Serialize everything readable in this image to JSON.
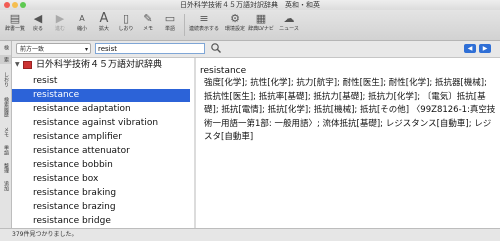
{
  "window": {
    "title": "日外科学技術４５万語対訳辞典　英和・和英"
  },
  "toolbar": {
    "buttons": [
      {
        "label": "辞書一覧",
        "icon": "dictionary-list-icon",
        "glyph": "▤"
      },
      {
        "label": "戻る",
        "icon": "back-icon",
        "glyph": "◀"
      },
      {
        "label": "進む",
        "icon": "forward-icon",
        "glyph": "▶"
      },
      {
        "label": "縮小",
        "icon": "shrink-text-icon",
        "glyph": "A"
      },
      {
        "label": "拡大",
        "icon": "enlarge-text-icon",
        "glyph": "A"
      },
      {
        "label": "しおり",
        "icon": "bookmark-icon",
        "glyph": "▯"
      },
      {
        "label": "メモ",
        "icon": "memo-icon",
        "glyph": "✎"
      },
      {
        "label": "単語",
        "icon": "word-icon",
        "glyph": "▭"
      },
      {
        "label": "連続表示する",
        "icon": "continuous-display-icon",
        "glyph": "≡"
      },
      {
        "label": "環境設定",
        "icon": "preferences-icon",
        "glyph": "⚙"
      },
      {
        "label": "辞典LVナビ",
        "icon": "lv-navi-icon",
        "glyph": "▦"
      },
      {
        "label": "ニュース",
        "icon": "news-icon",
        "glyph": "☁"
      }
    ]
  },
  "side_tabs": [
    "検",
    "索",
    "しおり",
    "検索履歴",
    "メモ",
    "単語",
    "整理",
    "追加"
  ],
  "search": {
    "mode": "前方一致",
    "query": "resist"
  },
  "dictionary": {
    "name": "日外科学技術４５万語対訳辞典",
    "items": [
      "resist",
      "resistance",
      "resistance adaptation",
      "resistance against vibration",
      "resistance amplifier",
      "resistance attenuator",
      "resistance bobbin",
      "resistance box",
      "resistance braking",
      "resistance brazing",
      "resistance bridge"
    ],
    "selected_index": 1
  },
  "entry": {
    "headword": "resistance",
    "body": "強度[化学]; 抗性[化学]; 抗力[航宇]; 耐性[医生]; 耐性[化学]; 抵抗器[機械]; 抵抗性[医生]; 抵抗率[基礎]; 抵抗力[基礎]; 抵抗力[化学]; 〔電気〕抵抗[基礎]; 抵抗[電情]; 抵抗[化学]; 抵抗[機械]; 抵抗[その他] 〈99Z8126-1:真空技術一用語一第1部: 一般用語〉; 流体抵抗[基礎]; レジスタンス[自動車]; レジスタ[自動車]"
  },
  "status": {
    "text": "379件見つかりました。"
  }
}
